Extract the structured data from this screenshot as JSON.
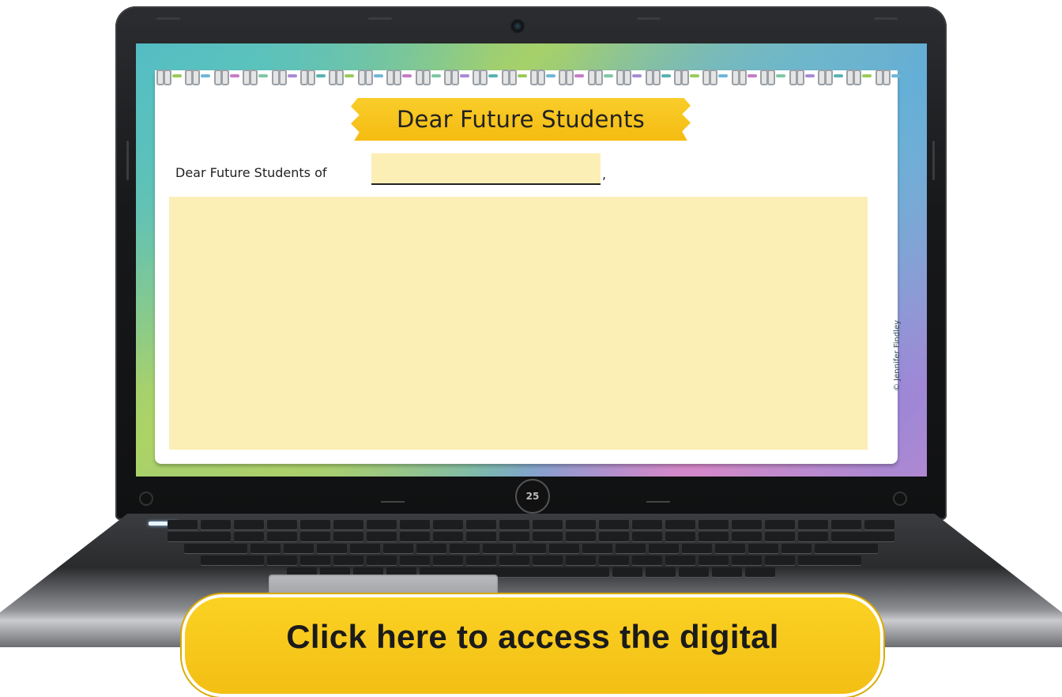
{
  "slide": {
    "title": "Dear Future Students",
    "salutation": "Dear Future Students of",
    "comma": ",",
    "school_name_value": "",
    "letter_body_value": "",
    "copyright": "© Jennifer Findley"
  },
  "device": {
    "logo_text": "25"
  },
  "cta": {
    "label": "Click here to access the digital"
  },
  "colors": {
    "banner_yellow": "#f7c41c",
    "input_fill": "#fcefb6",
    "cta_yellow": "#f7c41c",
    "ring_links": [
      "#9acb5a",
      "#6fb7d8",
      "#c77cc4",
      "#7fc7a5",
      "#a88bd6",
      "#58b3b0"
    ]
  }
}
